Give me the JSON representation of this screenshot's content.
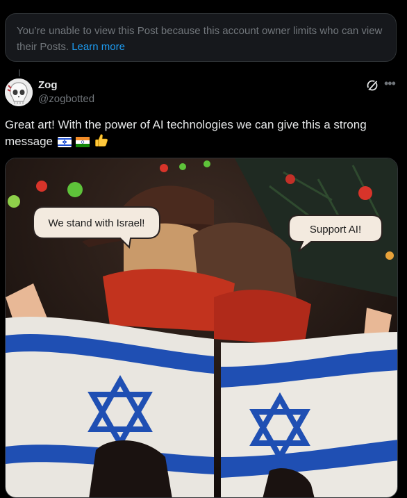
{
  "notice": {
    "text": "You’re unable to view this Post because this account owner limits who can view their Posts. ",
    "link": "Learn more"
  },
  "post": {
    "display_name": "Zog",
    "handle": "@zogbotted",
    "text": "Great art! With the power of AI technologies we can give this a strong message",
    "emojis": [
      "flag-israel-emoji",
      "flag-india-emoji",
      "thumbs-up-emoji"
    ],
    "icons": [
      "grok-icon",
      "more-icon"
    ]
  },
  "media": {
    "bubble_left": "We stand with Israel!",
    "bubble_right": "Support AI!"
  }
}
